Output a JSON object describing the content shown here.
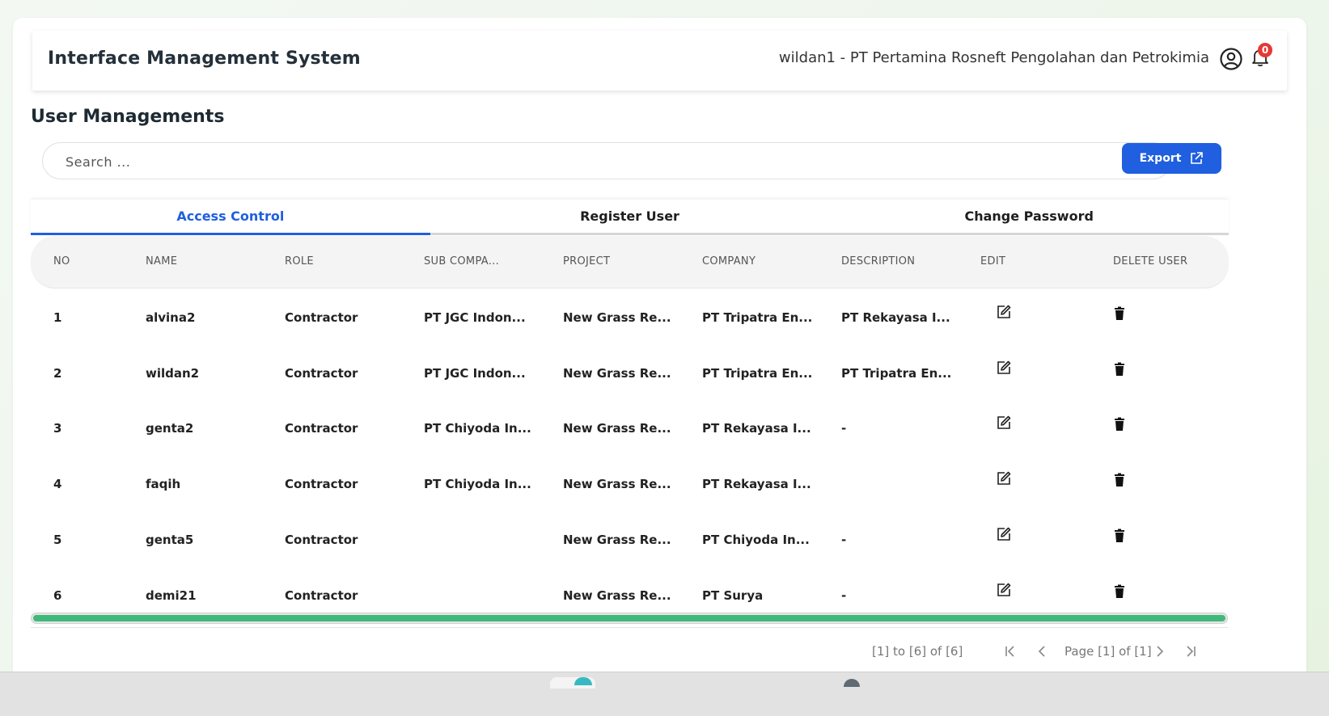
{
  "header": {
    "app_title": "Interface Management System",
    "user_info": "wildan1 - PT Pertamina Rosneft Pengolahan dan Petrokimia",
    "notification_count": "0"
  },
  "page": {
    "title": "User Managements"
  },
  "search": {
    "placeholder": "Search ...",
    "value": ""
  },
  "export": {
    "label": "Export"
  },
  "tabs": [
    {
      "label": "Access Control",
      "active": true
    },
    {
      "label": "Register User",
      "active": false
    },
    {
      "label": "Change Password",
      "active": false
    }
  ],
  "table": {
    "columns": [
      "NO",
      "NAME",
      "ROLE",
      "SUB COMPA...",
      "PROJECT",
      "COMPANY",
      "DESCRIPTION",
      "EDIT",
      "DELETE USER"
    ],
    "rows": [
      {
        "no": "1",
        "name": "alvina2",
        "role": "Contractor",
        "sub_company": "PT JGC Indon...",
        "project": "New Grass Re...",
        "company": "PT Tripatra En...",
        "description": "PT Rekayasa I..."
      },
      {
        "no": "2",
        "name": "wildan2",
        "role": "Contractor",
        "sub_company": "PT JGC Indon...",
        "project": "New Grass Re...",
        "company": "PT Tripatra En...",
        "description": "PT Tripatra En..."
      },
      {
        "no": "3",
        "name": "genta2",
        "role": "Contractor",
        "sub_company": "PT Chiyoda In...",
        "project": "New Grass Re...",
        "company": "PT Rekayasa I...",
        "description": "-"
      },
      {
        "no": "4",
        "name": "faqih",
        "role": "Contractor",
        "sub_company": "PT Chiyoda In...",
        "project": "New Grass Re...",
        "company": "PT Rekayasa I...",
        "description": ""
      },
      {
        "no": "5",
        "name": "genta5",
        "role": "Contractor",
        "sub_company": "",
        "project": "New Grass Re...",
        "company": "PT Chiyoda In...",
        "description": "-"
      },
      {
        "no": "6",
        "name": "demi21",
        "role": "Contractor",
        "sub_company": "",
        "project": "New Grass Re...",
        "company": "PT Surya",
        "description": "-"
      }
    ]
  },
  "pagination": {
    "range": "[1] to [6] of [6]",
    "page": "Page [1] of [1]"
  },
  "colors": {
    "accent": "#1f5fe0",
    "scrollbar": "#3fb97a",
    "badge": "#e53935"
  }
}
